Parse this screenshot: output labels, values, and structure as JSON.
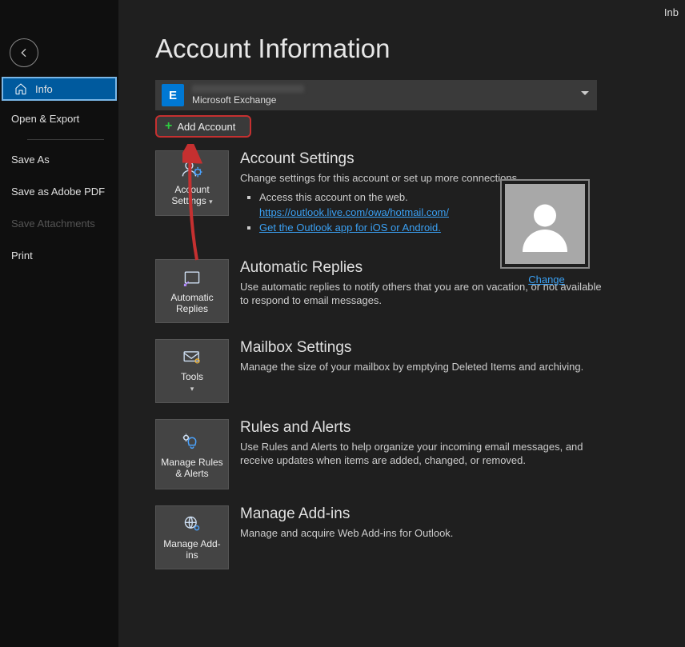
{
  "topright": "Inb",
  "sidebar": {
    "info": "Info",
    "open_export": "Open & Export",
    "save_as": "Save As",
    "save_adobe_pdf": "Save as Adobe PDF",
    "save_attachments": "Save Attachments",
    "print": "Print"
  },
  "page_title": "Account Information",
  "account": {
    "type": "Microsoft Exchange",
    "add_account": "Add Account"
  },
  "avatar_change": "Change",
  "sections": {
    "settings": {
      "tile": "Account Settings",
      "title": "Account Settings",
      "desc": "Change settings for this account or set up more connections.",
      "li1": "Access this account on the web.",
      "link1": "https://outlook.live.com/owa/hotmail.com/",
      "link2": "Get the Outlook app for iOS or Android."
    },
    "auto": {
      "tile": "Automatic Replies",
      "title": "Automatic Replies",
      "desc": "Use automatic replies to notify others that you are on vacation, or not available to respond to email messages."
    },
    "mailbox": {
      "tile": "Tools",
      "title": "Mailbox Settings",
      "desc": "Manage the size of your mailbox by emptying Deleted Items and archiving."
    },
    "rules": {
      "tile": "Manage Rules & Alerts",
      "title": "Rules and Alerts",
      "desc": "Use Rules and Alerts to help organize your incoming email messages, and receive updates when items are added, changed, or removed."
    },
    "addins": {
      "tile": "Manage Add-ins",
      "title": "Manage Add-ins",
      "desc": "Manage and acquire Web Add-ins for Outlook."
    }
  }
}
